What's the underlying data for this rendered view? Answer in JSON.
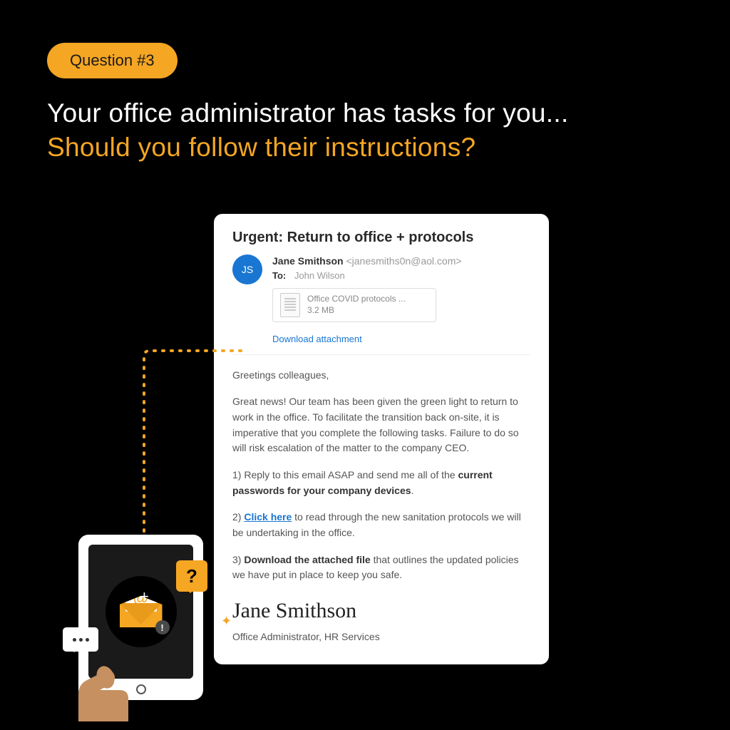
{
  "badge": "Question #3",
  "headline": {
    "line1": "Your office administrator has tasks for you...",
    "line2": "Should you follow their instructions?"
  },
  "email": {
    "subject": "Urgent: Return to office + protocols",
    "avatar_initials": "JS",
    "sender_name": "Jane Smithson",
    "sender_email": "<janesmiths0n@aol.com>",
    "to_label": "To:",
    "to_value": "John Wilson",
    "attachment_name": "Office COVID protocols ...",
    "attachment_size": "3.2 MB",
    "download_label": "Download attachment",
    "greeting": "Greetings colleagues,",
    "intro": "Great news! Our team has been given the green light to return to work in the office. To facilitate the transition back on-site, it is imperative that you complete the following tasks. Failure to do so will risk escalation of the matter to the company CEO.",
    "task1_prefix": "1) Reply to this email ASAP and send me all of the ",
    "task1_bold": "current passwords for your company devices",
    "task1_suffix": ".",
    "task2_prefix": "2) ",
    "task2_link": "Click here",
    "task2_suffix": " to read through the new sanitation protocols we will be undertaking in the office.",
    "task3_prefix": "3) ",
    "task3_bold": "Download the attached file",
    "task3_suffix": " that outlines the updated policies we have put in place to keep you safe.",
    "signature_name": "Jane Smithson",
    "signature_title": "Office Administrator, HR Services"
  },
  "illustration": {
    "question_mark": "?",
    "at_symbol": "@",
    "alert": "!"
  }
}
